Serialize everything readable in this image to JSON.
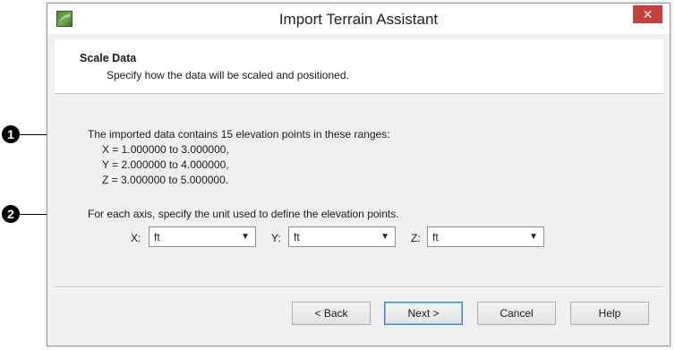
{
  "window": {
    "title": "Import Terrain Assistant",
    "close_glyph": "✕"
  },
  "header": {
    "title": "Scale Data",
    "subtitle": "Specify how the data will be scaled and positioned."
  },
  "info": {
    "summary": "The imported data contains 15 elevation points in these ranges:",
    "ranges": [
      "X = 1.000000 to 3.000000,",
      "Y = 2.000000 to 4.000000,",
      "Z = 3.000000 to 5.000000."
    ]
  },
  "units": {
    "instruction": "For each axis, specify the unit used to define the elevation points.",
    "axes": [
      {
        "label": "X:",
        "value": "ft"
      },
      {
        "label": "Y:",
        "value": "ft"
      },
      {
        "label": "Z:",
        "value": "ft"
      }
    ]
  },
  "buttons": {
    "back": "< Back",
    "next": "Next >",
    "cancel": "Cancel",
    "help": "Help"
  },
  "callouts": [
    "1",
    "2"
  ],
  "colors": {
    "close_button": "#c7403d",
    "default_button_border": "#3c7fd1",
    "dialog_bg": "#f0f0f0"
  }
}
